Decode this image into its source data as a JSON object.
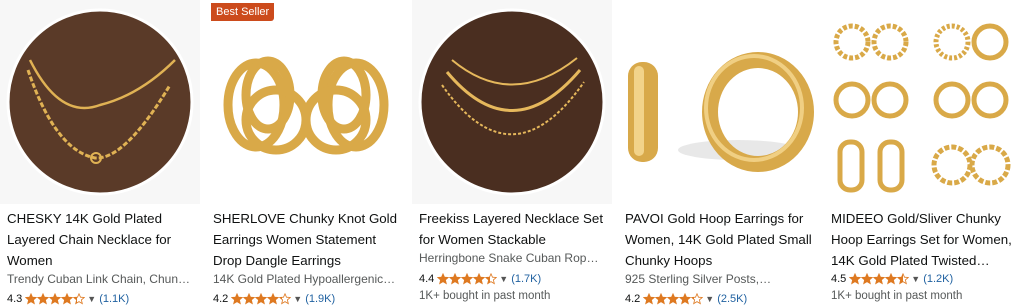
{
  "products": [
    {
      "title": "CHESKY 14K Gold Plated Layered Chain Necklace for Women",
      "subtitle": "Trendy Cuban Link Chain, Chunk…",
      "rating": "4.3",
      "stars": 4.3,
      "reviews": "(1.1K)",
      "bought": "",
      "badge": ""
    },
    {
      "title": "SHERLOVE Chunky Knot Gold Earrings Women Statement Drop Dangle Earrings",
      "subtitle": "14K Gold Plated Hypoallergenic…",
      "rating": "4.2",
      "stars": 4.2,
      "reviews": "(1.9K)",
      "bought": "",
      "badge": "Best Seller"
    },
    {
      "title": "Freekiss Layered Necklace Set for Women Stackable",
      "subtitle": "Herringbone Snake Cuban Rope…",
      "rating": "4.4",
      "stars": 4.4,
      "reviews": "(1.7K)",
      "bought": "1K+ bought in past month",
      "badge": ""
    },
    {
      "title": "PAVOI Gold Hoop Earrings for Women, 14K Gold Plated Small Chunky Hoops",
      "subtitle": "925 Sterling Silver Posts,…",
      "rating": "4.2",
      "stars": 4.2,
      "reviews": "(2.5K)",
      "bought": "",
      "badge": ""
    },
    {
      "title": "MIDEEO Gold/Sliver Chunky Hoop Earrings Set for Women, 14K Gold Plated Twisted…",
      "subtitle": "",
      "rating": "4.5",
      "stars": 4.5,
      "reviews": "(1.2K)",
      "bought": "1K+ bought in past month",
      "badge": ""
    }
  ],
  "colors": {
    "star": "#de7921",
    "link": "#2162a1",
    "badge": "#cc4b1c",
    "gold": "#d9a948"
  }
}
